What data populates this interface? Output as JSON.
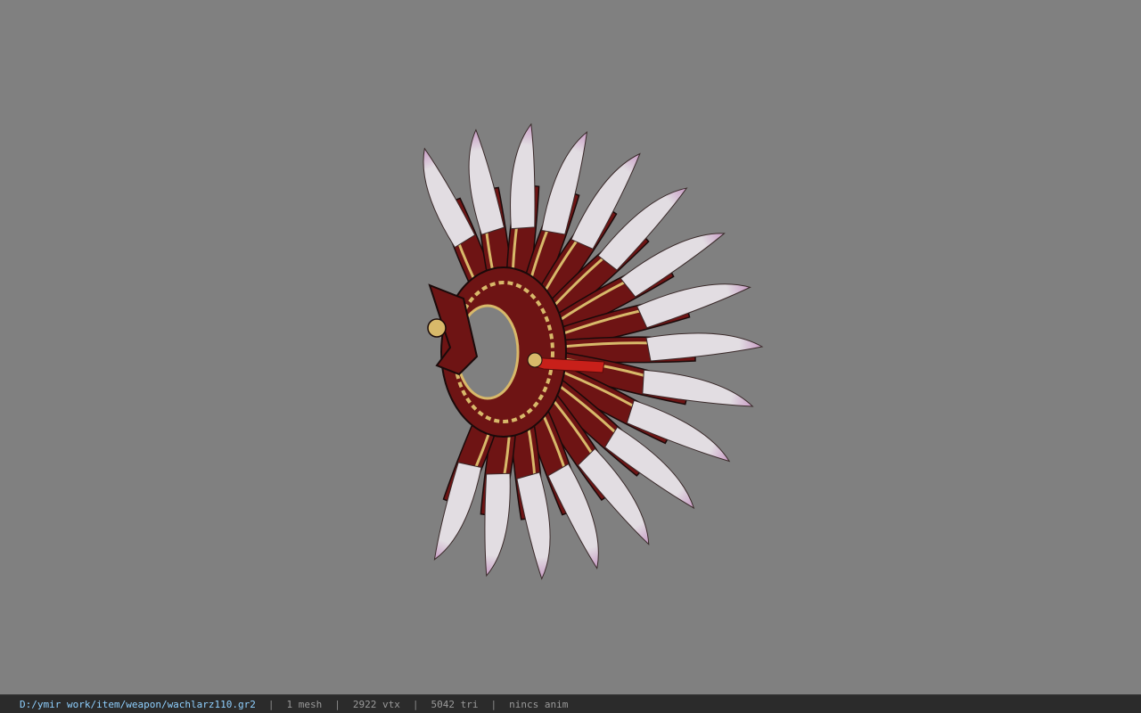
{
  "viewer": {
    "background_color": "#808080",
    "model_name": "wachlarz110.gr2",
    "model_colors": {
      "blade": "#e2dde2",
      "blade_tip": "#c79ac4",
      "body": "#6e1414",
      "trim": "#d8b96a",
      "outline": "#1a0a0a",
      "tassel": "#c8201a"
    }
  },
  "status": {
    "path": "D:/ymir work/item/weapon/wachlarz110.gr2",
    "meshes": "1 mesh",
    "vertices": "2922 vtx",
    "triangles": "5042 tri",
    "animation": "nincs anim",
    "separator": "|"
  }
}
